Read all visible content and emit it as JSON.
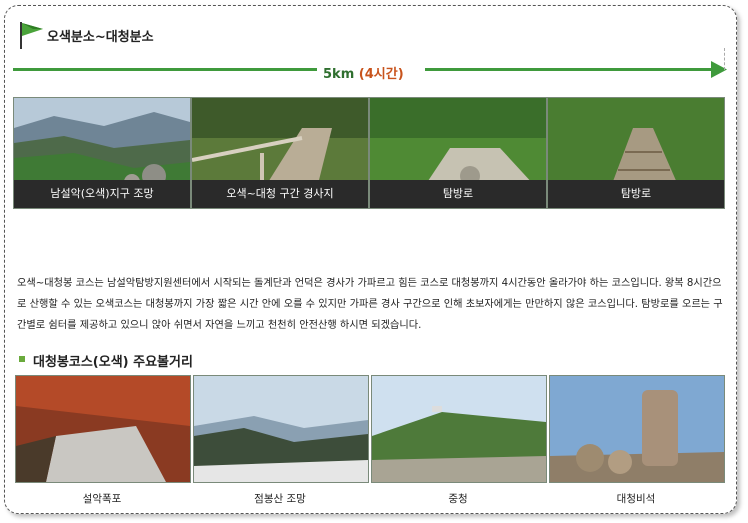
{
  "route": {
    "title": "오색분소~대청분소",
    "distance": "5km",
    "duration": "(4시간)"
  },
  "course_photos": [
    {
      "caption": "남설악(오색)지구 조망"
    },
    {
      "caption": "오색~대청 구간 경사지"
    },
    {
      "caption": "탐방로"
    },
    {
      "caption": "탐방로"
    }
  ],
  "description": "오색~대청봉 코스는 남설악탐방지원센터에서 시작되는 돌계단과 언덕은 경사가 가파르고 힘든 코스로 대청봉까지 4시간동안 올라가야 하는 코스입니다. 왕복 8시간으로 산행할 수 있는 오색코스는 대청봉까지 가장 짧은 시간 안에 오를 수 있지만 가파른 경사 구간으로 인해 초보자에게는 만만하지 않은 코스입니다. 탐방로를 오르는 구간별로 쉼터를 제공하고 있으니 앉아 쉬면서 자연을 느끼고 천천히 안전산행 하시면 되겠습니다.",
  "sights": {
    "heading": "대청봉코스(오색) 주요볼거리",
    "items": [
      {
        "caption": "설악폭포"
      },
      {
        "caption": "점봉산 조망"
      },
      {
        "caption": "중청"
      },
      {
        "caption": "대청비석"
      }
    ]
  },
  "colors": {
    "accent_green": "#3f9a3c",
    "duration_orange": "#c8531c",
    "caption_bg": "#2a2a2a"
  }
}
